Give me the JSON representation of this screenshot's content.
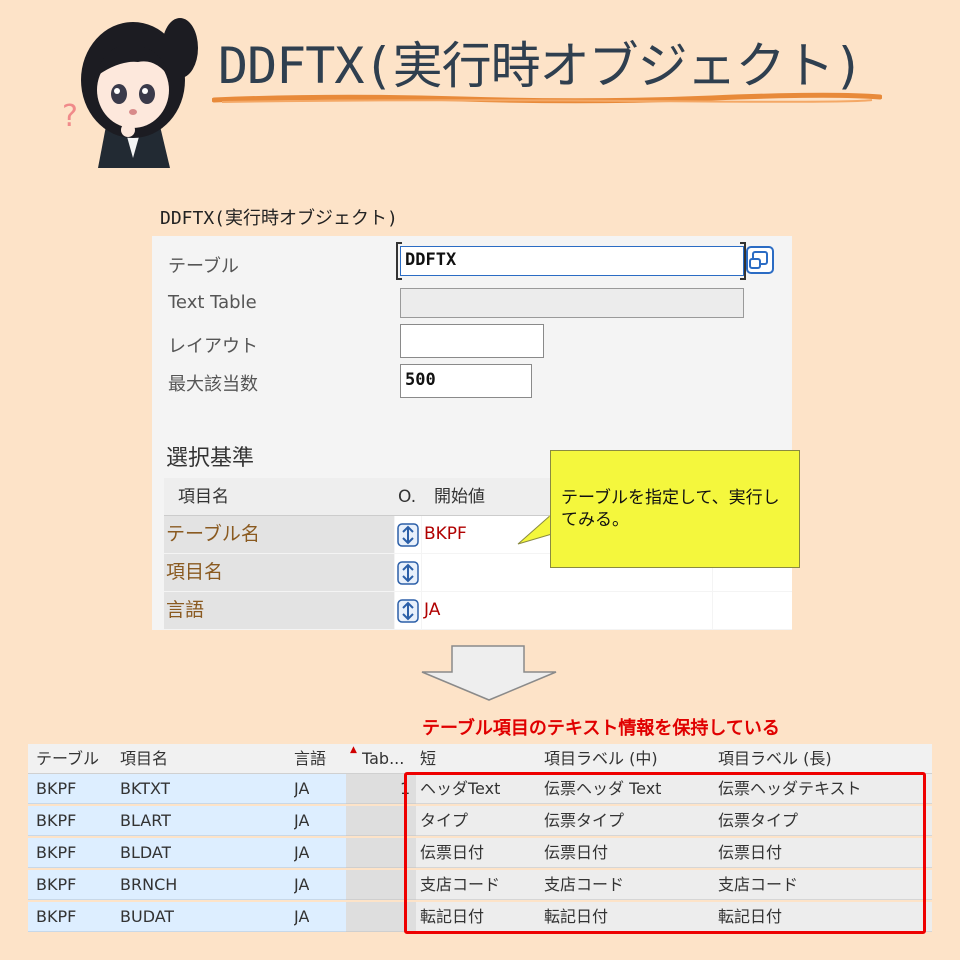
{
  "header": {
    "title": "DDFTX(実行時オブジェクト)",
    "question_mark": "?"
  },
  "section_caption": "DDFTX(実行時オブジェクト)",
  "form": {
    "fields": [
      {
        "label": "テーブル",
        "value": ""
      },
      {
        "label": "Text Table",
        "value": ""
      },
      {
        "label": "レイアウト",
        "value": ""
      },
      {
        "label": "最大該当数",
        "value": "500"
      }
    ],
    "table_value": "DDFTX",
    "group_title": "選択基準",
    "criteria_headers": {
      "name": "項目名",
      "op": "O.",
      "from": "開始値"
    },
    "criteria_rows": [
      {
        "name": "テーブル名",
        "value": "BKPF"
      },
      {
        "name": "項目名",
        "value": ""
      },
      {
        "name": "言語",
        "value": "JA"
      }
    ]
  },
  "callout": {
    "text": "テーブルを指定して、実行してみる。"
  },
  "annotation": "テーブル項目のテキスト情報を保持している",
  "results": {
    "headers": [
      "テーブル",
      "項目名",
      "言語",
      "Tab...",
      "短",
      "項目ラベル (中)",
      "項目ラベル (長)"
    ],
    "rows": [
      {
        "table": "BKPF",
        "field": "BKTXT",
        "lang": "JA",
        "tab": "1",
        "short": "ヘッダText",
        "medium": "伝票ヘッダ Text",
        "long": "伝票ヘッダテキスト"
      },
      {
        "table": "BKPF",
        "field": "BLART",
        "lang": "JA",
        "tab": "",
        "short": "タイプ",
        "medium": "伝票タイプ",
        "long": "伝票タイプ"
      },
      {
        "table": "BKPF",
        "field": "BLDAT",
        "lang": "JA",
        "tab": "",
        "short": "伝票日付",
        "medium": "伝票日付",
        "long": "伝票日付"
      },
      {
        "table": "BKPF",
        "field": "BRNCH",
        "lang": "JA",
        "tab": "",
        "short": "支店コード",
        "medium": "支店コード",
        "long": "支店コード"
      },
      {
        "table": "BKPF",
        "field": "BUDAT",
        "lang": "JA",
        "tab": "",
        "short": "転記日付",
        "medium": "転記日付",
        "long": "転記日付"
      }
    ]
  },
  "colors": {
    "background": "#fde3c8",
    "title": "#2f3f4f",
    "annotation": "#e00000",
    "callout": "#f4f73d",
    "criteria_name": "#8a5a20",
    "criteria_value": "#b00000"
  }
}
